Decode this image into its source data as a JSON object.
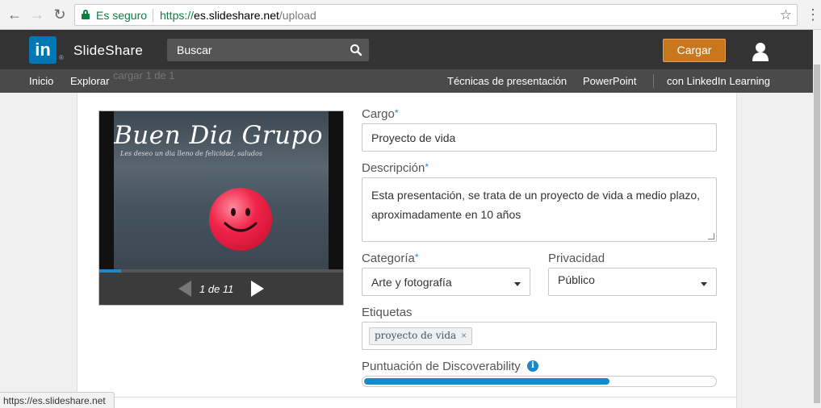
{
  "browser": {
    "secure_label": "Es seguro",
    "url_scheme": "https://",
    "url_host": "es.slideshare.net",
    "url_path": "/upload",
    "status_url": "https://es.slideshare.net"
  },
  "header": {
    "logo_text": "in",
    "brand": "SlideShare",
    "search_placeholder": "Buscar",
    "upload_label": "Cargar"
  },
  "subnav": {
    "left": [
      "Inicio",
      "Explorar"
    ],
    "right": [
      "Técnicas de presentación",
      "PowerPoint",
      "con LinkedIn Learning"
    ],
    "ghost_text": "cargar 1 de 1"
  },
  "player": {
    "slide_title": "Buen Dia Grupo",
    "slide_subtitle": "Les deseo un dia lleno de felicidad, saludos",
    "current_page": 1,
    "total_pages": 11,
    "page_label": "1 de 11",
    "progress": 0.09
  },
  "form": {
    "title_label": "Cargo",
    "title_value": "Proyecto de vida",
    "description_label": "Descripción",
    "description_value": "Esta presentación, se trata de un proyecto de vida a medio plazo, aproximadamente en 10 años",
    "category_label": "Categoría",
    "category_value": "Arte y fotografía",
    "privacy_label": "Privacidad",
    "privacy_value": "Público",
    "tags_label": "Etiquetas",
    "tags": [
      "proyecto de vida"
    ],
    "discoverability_label": "Puntuación de Discoverability",
    "discoverability_score": 0.7,
    "required_mark": "*"
  },
  "colors": {
    "accent": "#1c87c9",
    "upload": "#c8771d",
    "linkedin": "#0077b5",
    "secure": "#0b8043"
  }
}
